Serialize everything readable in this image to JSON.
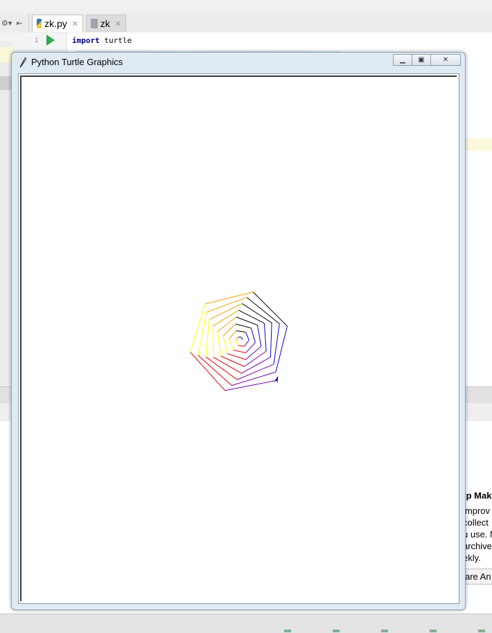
{
  "ide": {
    "tabs": [
      {
        "label": "zk.py",
        "icon": "python-file-icon",
        "active": true
      },
      {
        "label": "zk",
        "icon": "text-file-icon",
        "active": false
      }
    ],
    "editor": {
      "line_number": "1",
      "code_keyword": "import",
      "code_rest": " turtle"
    },
    "help_popup": {
      "title_fragment": "lp Mak",
      "lines": [
        "improv",
        "collect",
        "u use. N",
        "archive",
        "ekly."
      ],
      "button_fragment": "are An"
    }
  },
  "turtle_window": {
    "title": "Python Turtle Graphics",
    "icon": "feather-icon",
    "controls": [
      "minimize-icon",
      "maximize-icon",
      "close-icon"
    ],
    "drawing": {
      "shape": "hexagon spiral",
      "sides": 6,
      "colors": [
        "red",
        "purple",
        "blue",
        "green",
        "orange",
        "yellow"
      ],
      "stroke_colors": {
        "red": "#e00000",
        "purple": "#7a00b0",
        "blue": "#0000cc",
        "green": "#000000",
        "orange": "#f0a000",
        "yellow": "#ffff00"
      },
      "segments": 50,
      "turn_angle": 59,
      "turtle_color": "#000060"
    }
  }
}
